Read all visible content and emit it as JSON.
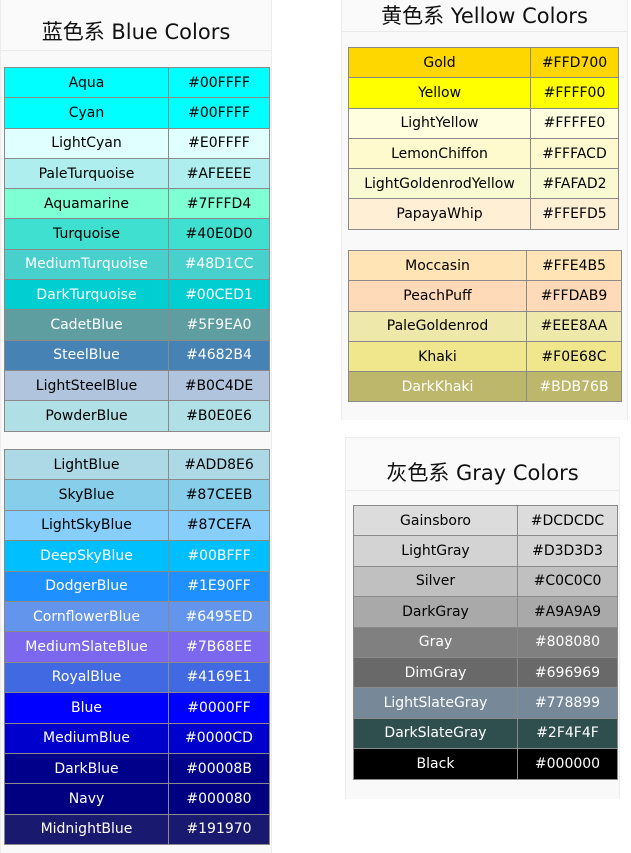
{
  "blue": {
    "title": "蓝色系 Blue Colors",
    "table1": [
      {
        "name": "Aqua",
        "hex": "#00FFFF",
        "bg": "#00FFFF",
        "fg": "#000000"
      },
      {
        "name": "Cyan",
        "hex": "#00FFFF",
        "bg": "#00FFFF",
        "fg": "#000000"
      },
      {
        "name": "LightCyan",
        "hex": "#E0FFFF",
        "bg": "#E0FFFF",
        "fg": "#000000"
      },
      {
        "name": "PaleTurquoise",
        "hex": "#AFEEEE",
        "bg": "#AFEEEE",
        "fg": "#000000"
      },
      {
        "name": "Aquamarine",
        "hex": "#7FFFD4",
        "bg": "#7FFFD4",
        "fg": "#000000"
      },
      {
        "name": "Turquoise",
        "hex": "#40E0D0",
        "bg": "#40E0D0",
        "fg": "#000000"
      },
      {
        "name": "MediumTurquoise",
        "hex": "#48D1CC",
        "bg": "#48D1CC",
        "fg": "#FFFFFF"
      },
      {
        "name": "DarkTurquoise",
        "hex": "#00CED1",
        "bg": "#00CED1",
        "fg": "#FFFFFF"
      },
      {
        "name": "CadetBlue",
        "hex": "#5F9EA0",
        "bg": "#5F9EA0",
        "fg": "#FFFFFF"
      },
      {
        "name": "SteelBlue",
        "hex": "#4682B4",
        "bg": "#4682B4",
        "fg": "#FFFFFF"
      },
      {
        "name": "LightSteelBlue",
        "hex": "#B0C4DE",
        "bg": "#B0C4DE",
        "fg": "#000000"
      },
      {
        "name": "PowderBlue",
        "hex": "#B0E0E6",
        "bg": "#B0E0E6",
        "fg": "#000000"
      }
    ],
    "table2": [
      {
        "name": "LightBlue",
        "hex": "#ADD8E6",
        "bg": "#ADD8E6",
        "fg": "#000000"
      },
      {
        "name": "SkyBlue",
        "hex": "#87CEEB",
        "bg": "#87CEEB",
        "fg": "#000000"
      },
      {
        "name": "LightSkyBlue",
        "hex": "#87CEFA",
        "bg": "#87CEFA",
        "fg": "#000000"
      },
      {
        "name": "DeepSkyBlue",
        "hex": "#00BFFF",
        "bg": "#00BFFF",
        "fg": "#FFFFFF"
      },
      {
        "name": "DodgerBlue",
        "hex": "#1E90FF",
        "bg": "#1E90FF",
        "fg": "#FFFFFF"
      },
      {
        "name": "CornflowerBlue",
        "hex": "#6495ED",
        "bg": "#6495ED",
        "fg": "#FFFFFF"
      },
      {
        "name": "MediumSlateBlue",
        "hex": "#7B68EE",
        "bg": "#7B68EE",
        "fg": "#FFFFFF"
      },
      {
        "name": "RoyalBlue",
        "hex": "#4169E1",
        "bg": "#4169E1",
        "fg": "#FFFFFF"
      },
      {
        "name": "Blue",
        "hex": "#0000FF",
        "bg": "#0000FF",
        "fg": "#FFFFFF"
      },
      {
        "name": "MediumBlue",
        "hex": "#0000CD",
        "bg": "#0000CD",
        "fg": "#FFFFFF"
      },
      {
        "name": "DarkBlue",
        "hex": "#00008B",
        "bg": "#00008B",
        "fg": "#FFFFFF"
      },
      {
        "name": "Navy",
        "hex": "#000080",
        "bg": "#000080",
        "fg": "#FFFFFF"
      },
      {
        "name": "MidnightBlue",
        "hex": "#191970",
        "bg": "#191970",
        "fg": "#FFFFFF"
      }
    ]
  },
  "yellow": {
    "title": "黄色系 Yellow Colors",
    "table1": [
      {
        "name": "Gold",
        "hex": "#FFD700",
        "bg": "#FFD700",
        "fg": "#000000"
      },
      {
        "name": "Yellow",
        "hex": "#FFFF00",
        "bg": "#FFFF00",
        "fg": "#000000"
      },
      {
        "name": "LightYellow",
        "hex": "#FFFFE0",
        "bg": "#FFFFE0",
        "fg": "#000000"
      },
      {
        "name": "LemonChiffon",
        "hex": "#FFFACD",
        "bg": "#FFFACD",
        "fg": "#000000"
      },
      {
        "name": "LightGoldenrodYellow",
        "hex": "#FAFAD2",
        "bg": "#FAFAD2",
        "fg": "#000000"
      },
      {
        "name": "PapayaWhip",
        "hex": "#FFEFD5",
        "bg": "#FFEFD5",
        "fg": "#000000"
      }
    ],
    "table2": [
      {
        "name": "Moccasin",
        "hex": "#FFE4B5",
        "bg": "#FFE4B5",
        "fg": "#000000"
      },
      {
        "name": "PeachPuff",
        "hex": "#FFDAB9",
        "bg": "#FFDAB9",
        "fg": "#000000"
      },
      {
        "name": "PaleGoldenrod",
        "hex": "#EEE8AA",
        "bg": "#EEE8AA",
        "fg": "#000000"
      },
      {
        "name": "Khaki",
        "hex": "#F0E68C",
        "bg": "#F0E68C",
        "fg": "#000000"
      },
      {
        "name": "DarkKhaki",
        "hex": "#BDB76B",
        "bg": "#BDB76B",
        "fg": "#FFFFFF"
      }
    ]
  },
  "gray": {
    "title": "灰色系 Gray Colors",
    "table1": [
      {
        "name": "Gainsboro",
        "hex": "#DCDCDC",
        "bg": "#DCDCDC",
        "fg": "#000000"
      },
      {
        "name": "LightGray",
        "hex": "#D3D3D3",
        "bg": "#D3D3D3",
        "fg": "#000000"
      },
      {
        "name": "Silver",
        "hex": "#C0C0C0",
        "bg": "#C0C0C0",
        "fg": "#000000"
      },
      {
        "name": "DarkGray",
        "hex": "#A9A9A9",
        "bg": "#A9A9A9",
        "fg": "#000000"
      },
      {
        "name": "Gray",
        "hex": "#808080",
        "bg": "#808080",
        "fg": "#FFFFFF"
      },
      {
        "name": "DimGray",
        "hex": "#696969",
        "bg": "#696969",
        "fg": "#FFFFFF"
      },
      {
        "name": "LightSlateGray",
        "hex": "#778899",
        "bg": "#778899",
        "fg": "#FFFFFF"
      },
      {
        "name": "DarkSlateGray",
        "hex": "#2F4F4F",
        "bg": "#2F4F4F",
        "fg": "#FFFFFF"
      },
      {
        "name": "Black",
        "hex": "#000000",
        "bg": "#000000",
        "fg": "#FFFFFF"
      }
    ]
  }
}
